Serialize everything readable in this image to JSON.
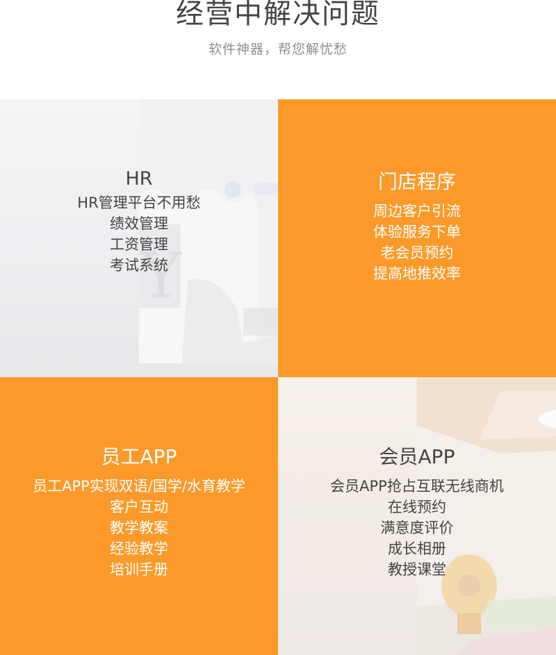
{
  "header": {
    "title": "经营中解决问题",
    "subtitle": "软件神器，帮您解忧愁"
  },
  "colors": {
    "accent_orange": "#fb9a2a",
    "title_gray": "#444444",
    "subtitle_gray": "#8f8f8f"
  },
  "cells": [
    {
      "title": "HR",
      "items": [
        "HR管理平台不用愁",
        "绩效管理",
        "工资管理",
        "考试系统"
      ]
    },
    {
      "title": "门店程序",
      "items": [
        "周边客户引流",
        "体验服务下单",
        "老会员预约",
        "提高地推效率"
      ]
    },
    {
      "title": "员工APP",
      "items": [
        "员工APP实现双语/国学/水育教学",
        "客户互动",
        "教学教案",
        "经验教学",
        "培训手册"
      ]
    },
    {
      "title": "会员APP",
      "items": [
        "会员APP抢占互联无线商机",
        "在线预约",
        "满意度评价",
        "成长相册",
        "教授课堂"
      ]
    }
  ]
}
